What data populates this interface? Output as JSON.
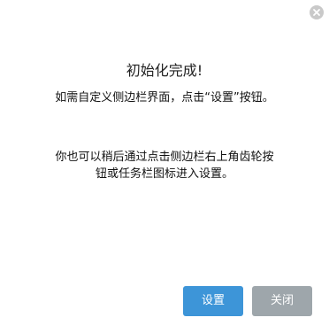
{
  "dialog": {
    "title": "初始化完成!",
    "paragraph_1": "如需自定义侧边栏界面，点击“设置”按钮。",
    "paragraph_2": "你也可以稍后通过点击侧边栏右上角齿轮按钮或任务栏图标进入设置。",
    "buttons": {
      "settings_label": "设置",
      "close_label": "关闭"
    },
    "close_icon": "close-icon",
    "colors": {
      "primary_button": "#3d95d8",
      "secondary_button": "#9ea6ab",
      "close_icon_bg": "#c9c9c9"
    }
  }
}
